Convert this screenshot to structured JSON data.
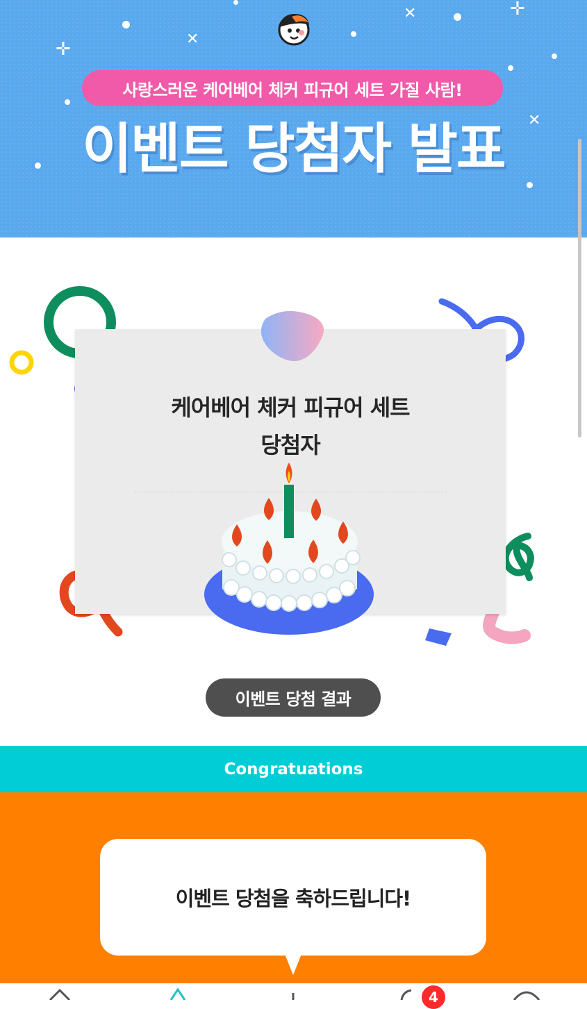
{
  "header": {
    "tagline": "사랑스러운 케어베어 체커 피규어 세트 가질 사람!",
    "title": "이벤트 당첨자 발표",
    "background_color": "#5aa9ee",
    "tagline_color": "#f15aa8"
  },
  "card": {
    "title_line1": "케어베어 체커 피규어 세트",
    "title_line2": "당첨자",
    "cake_icon": "birthday-cake-icon"
  },
  "result_button": {
    "label": "이벤트 당첨 결과"
  },
  "congrats_band": {
    "label": "Congratuations",
    "color": "#00cdd6"
  },
  "message": {
    "text": "이벤트 당첨을 축하드립니다!",
    "section_color": "#ff8000"
  },
  "bottom_nav": {
    "items": [
      {
        "icon": "home-icon"
      },
      {
        "icon": "navigation-icon"
      },
      {
        "icon": "plus-icon"
      },
      {
        "icon": "notification-bell-icon",
        "badge": "4"
      },
      {
        "icon": "profile-icon"
      }
    ]
  }
}
